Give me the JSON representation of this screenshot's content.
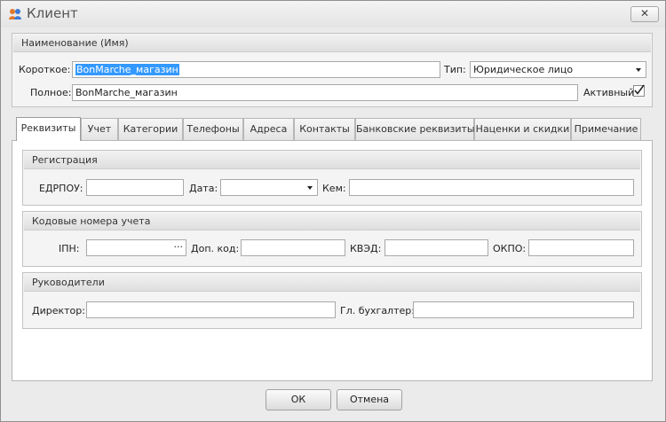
{
  "window": {
    "title": "Клиент",
    "close_label": "✕"
  },
  "name_group": {
    "title": "Наименование (Имя)",
    "short_label": "Короткое:",
    "short_value": "BonMarche_магазин",
    "full_label": "Полное:",
    "full_value": "BonMarche_магазин",
    "type_label": "Тип:",
    "type_value": "Юридическое лицо",
    "active_label": "Активный",
    "active_checked": true
  },
  "tabs": [
    {
      "label": "Реквизиты",
      "active": true
    },
    {
      "label": "Учет",
      "active": false
    },
    {
      "label": "Категории",
      "active": false
    },
    {
      "label": "Телефоны",
      "active": false
    },
    {
      "label": "Адреса",
      "active": false
    },
    {
      "label": "Контакты",
      "active": false
    },
    {
      "label": "Банковские реквизиты",
      "active": false
    },
    {
      "label": "Наценки и скидки",
      "active": false
    },
    {
      "label": "Примечание",
      "active": false
    }
  ],
  "registration": {
    "title": "Регистрация",
    "edrpou_label": "ЕДРПОУ:",
    "edrpou_value": "",
    "date_label": "Дата:",
    "date_value": "",
    "kem_label": "Кем:",
    "kem_value": ""
  },
  "codes": {
    "title": "Кодовые номера учета",
    "inn_label": "ІПН:",
    "inn_value": "",
    "inn_button": "···",
    "dop_label": "Доп. код:",
    "dop_value": "",
    "kved_label": "КВЭД:",
    "kved_value": "",
    "okpo_label": "ОКПО:",
    "okpo_value": ""
  },
  "managers": {
    "title": "Руководители",
    "director_label": "Директор:",
    "director_value": "",
    "accountant_label": "Гл. бухгалтер:",
    "accountant_value": ""
  },
  "footer": {
    "ok_label": "ОК",
    "cancel_label": "Отмена"
  },
  "colors": {
    "selection": "#3399ff",
    "window_bg": "#ebebeb"
  }
}
